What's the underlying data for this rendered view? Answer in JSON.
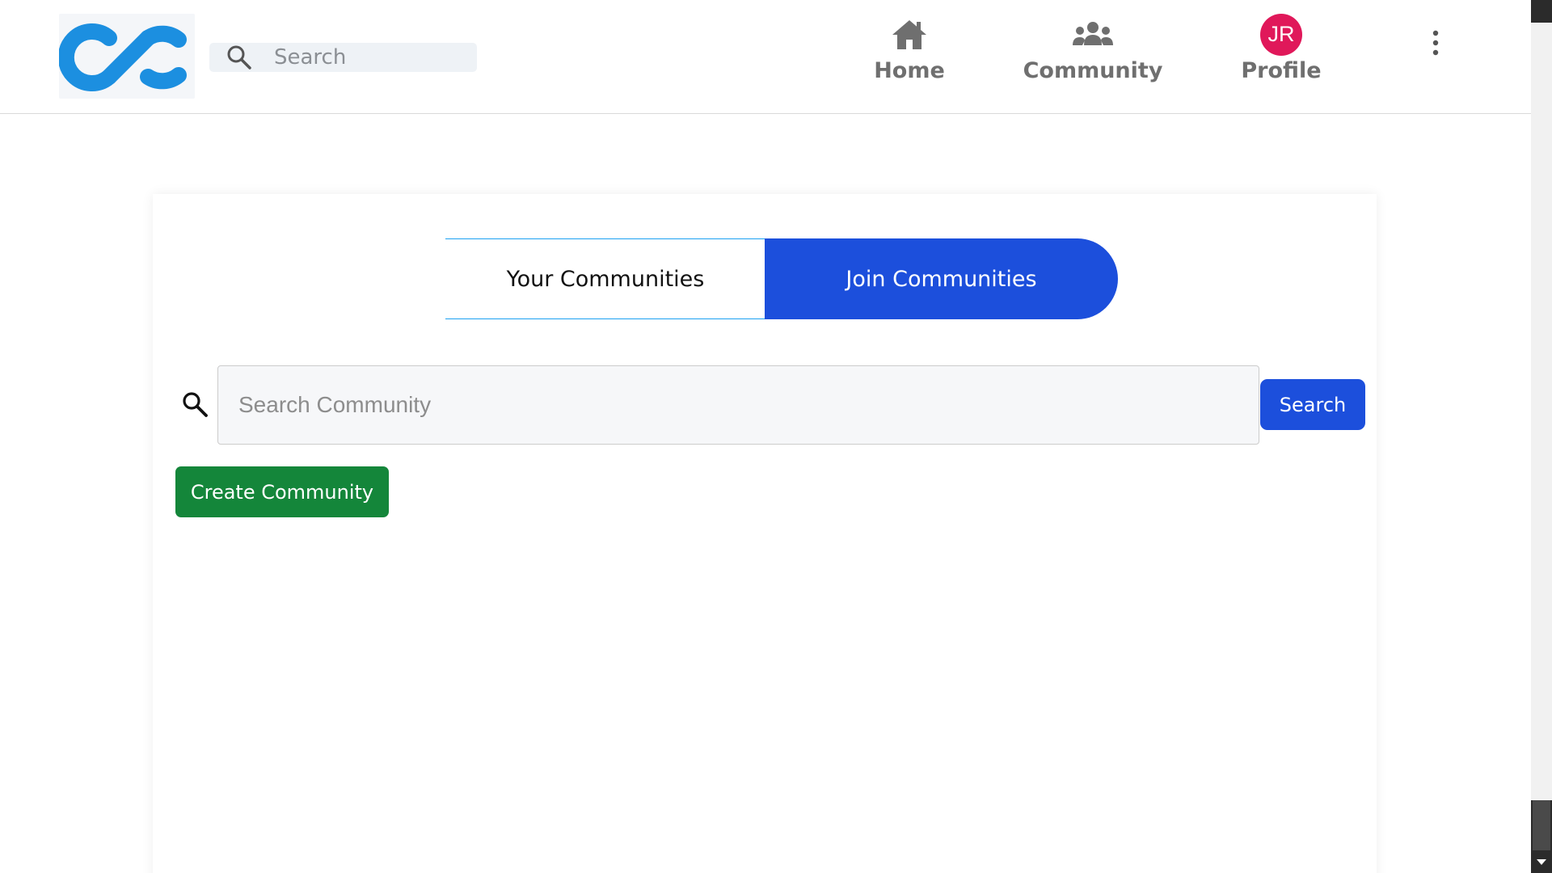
{
  "header": {
    "logo_icon": "cc-logo-icon",
    "search": {
      "placeholder": "Search",
      "value": "",
      "icon": "search-icon"
    },
    "nav": {
      "home": {
        "label": "Home",
        "icon": "home-icon"
      },
      "community": {
        "label": "Community",
        "icon": "people-group-icon"
      },
      "profile": {
        "label": "Profile",
        "avatar_initials": "JR"
      },
      "more_icon": "vertical-ellipsis-icon"
    }
  },
  "main": {
    "tabs": [
      {
        "label": "Your Communities",
        "active": false
      },
      {
        "label": "Join Communities",
        "active": true
      }
    ],
    "community_search": {
      "placeholder": "Search Community",
      "value": "",
      "icon": "search-icon",
      "button_label": "Search"
    },
    "create_button_label": "Create Community"
  },
  "colors": {
    "brand_blue": "#1c8fe0",
    "primary_button": "#1c4fdc",
    "success_button": "#14863a",
    "avatar_bg": "#e0185a",
    "nav_text": "#6f6f6f"
  }
}
